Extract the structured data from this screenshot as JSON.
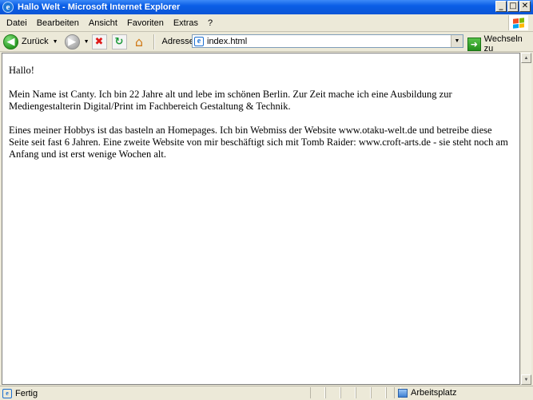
{
  "window": {
    "title": "Hallo Welt - Microsoft Internet Explorer",
    "controls": {
      "minimize": "_",
      "maximize": "□",
      "close": "✕"
    }
  },
  "menu": [
    "Datei",
    "Bearbeiten",
    "Ansicht",
    "Favoriten",
    "Extras",
    "?"
  ],
  "toolbar": {
    "back_label": "Zurück",
    "address_label": "Adresse",
    "address_value": "index.html",
    "go_label": "Wechseln zu"
  },
  "content": {
    "paragraphs": [
      "Hallo!",
      "Mein Name ist Canty. Ich bin 22 Jahre alt und lebe im schönen Berlin. Zur Zeit mache ich eine Ausbildung zur Mediengestalterin Digital/Print im Fachbereich Gestaltung & Technik.",
      "Eines meiner Hobbys ist das basteln an Homepages. Ich bin Webmiss der Website www.otaku-welt.de und betreibe diese Seite seit fast 6 Jahren. Eine zweite Website von mir beschäftigt sich mit Tomb Raider: www.croft-arts.de - sie steht noch am Anfang und ist erst wenige Wochen alt."
    ]
  },
  "statusbar": {
    "status": "Fertig",
    "zone": "Arbeitsplatz"
  },
  "colors": {
    "titlebar": "#0b55d6",
    "chrome": "#ece9d8",
    "content_bg": "#ffffff"
  },
  "icons": {
    "title": "ie-logo-icon",
    "back": "back-arrow-icon",
    "forward": "forward-arrow-icon",
    "stop": "stop-icon",
    "refresh": "refresh-icon",
    "home": "home-icon",
    "page": "page-icon",
    "go": "go-arrow-icon",
    "zone": "computer-icon"
  }
}
